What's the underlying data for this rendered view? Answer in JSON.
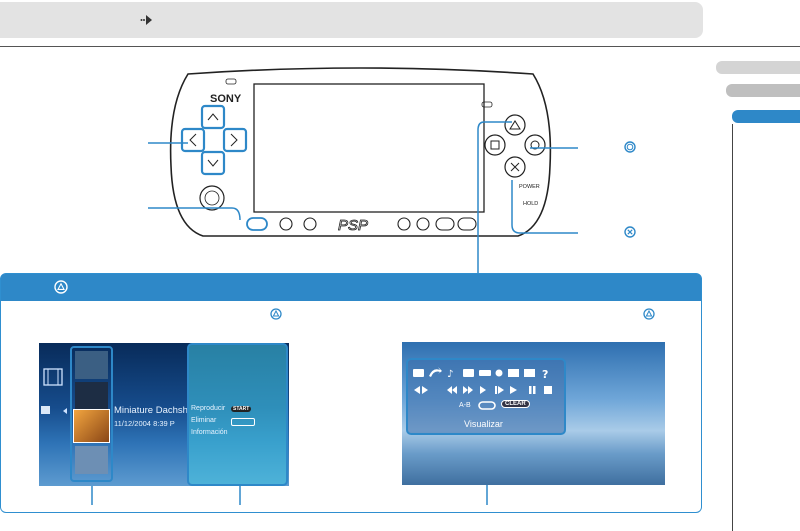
{
  "icons": {
    "dots_arrow": "dots-arrow-icon",
    "triangle": "triangle-button-icon",
    "circle": "circle-button-icon",
    "cross": "cross-button-icon"
  },
  "device": {
    "brand": "SONY",
    "logo": "PSP",
    "power_label": "POWER",
    "hold_label": "HOLD"
  },
  "screenshot_left": {
    "title": "Miniature Dachsh",
    "date": "11/12/2004  8:39 P",
    "menu": [
      "Reproducir",
      "Eliminar",
      "Información"
    ],
    "start_badge": "START"
  },
  "screenshot_right": {
    "ab_label": "A-B",
    "clear_badge": "CLEAR",
    "caption": "Visualizar"
  },
  "colors": {
    "accent": "#2e88c8",
    "topbar": "#e3e3e3",
    "side_tab_1": "#d4d4d4",
    "side_tab_2": "#bfbfbf",
    "side_tab_active": "#2e88c8"
  }
}
